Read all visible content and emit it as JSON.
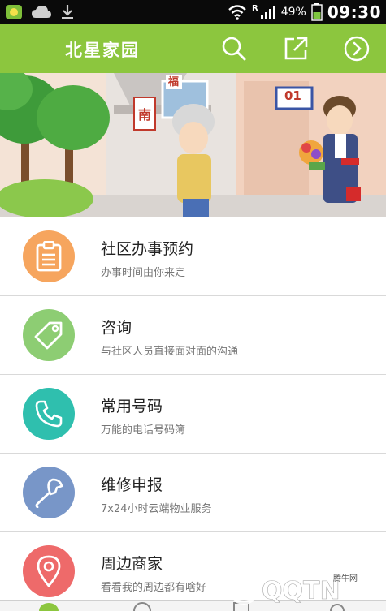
{
  "status_bar": {
    "battery": "49%",
    "time": "09:30",
    "roaming": "R",
    "icons": [
      "app-icon",
      "cloud-icon",
      "download-icon",
      "wifi-icon",
      "signal-icon",
      "battery-icon"
    ]
  },
  "header": {
    "title": "北星家园",
    "icons": [
      "search-icon",
      "share-icon",
      "next-icon"
    ],
    "background": "#8cc63e"
  },
  "banner": {
    "signs": [
      "南",
      "福",
      "01"
    ]
  },
  "menu": [
    {
      "title": "社区办事预约",
      "subtitle": "办事时间由你来定",
      "icon": "clipboard-icon",
      "color": "#f6a55e"
    },
    {
      "title": "咨询",
      "subtitle": "与社区人员直接面对面的沟通",
      "icon": "tag-icon",
      "color": "#8dcd73"
    },
    {
      "title": "常用号码",
      "subtitle": "万能的电话号码簿",
      "icon": "phone-icon",
      "color": "#2fbfae"
    },
    {
      "title": "维修申报",
      "subtitle": "7x24小时云端物业服务",
      "icon": "wrench-icon",
      "color": "#7896c8"
    },
    {
      "title": "周边商家",
      "subtitle": "看看我的周边都有啥好",
      "icon": "location-pin-icon",
      "color": "#ee6a6a"
    }
  ],
  "watermark": {
    "logo": "QQTN.com",
    "label": "腾牛网"
  }
}
